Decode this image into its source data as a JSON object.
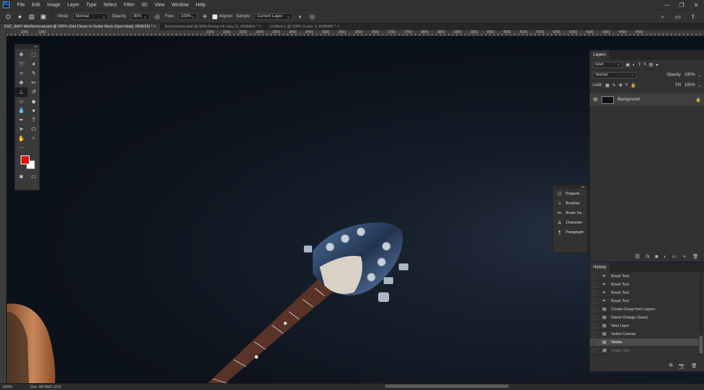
{
  "app": {
    "logo": "Ps"
  },
  "menu": [
    "File",
    "Edit",
    "Image",
    "Layer",
    "Type",
    "Select",
    "Filter",
    "3D",
    "View",
    "Window",
    "Help"
  ],
  "window_controls": {
    "minimize": "—",
    "restore": "❐",
    "close": "✕"
  },
  "options": {
    "mode_label": "Mode:",
    "mode_value": "Normal",
    "opacity_label": "Opacity:",
    "opacity_value": "30%",
    "flow_label": "Flow:",
    "flow_value": "100%",
    "aligned_label": "Aligned",
    "sample_label": "Sample:",
    "sample_value": "Current Layer"
  },
  "tabs": [
    "DSC_8497-MicRemoval.psd @ 200% (Get Closer to Guitar Neck (Spot Heal), RGB/16) * ×",
    "Screenshots.psd @ 50% (Group 14 copy 11, RGB/8#) * ×",
    "Untitled-1 @ 100% (Layer 2, RGB/8#) * ×"
  ],
  "ruler": [
    "1000",
    "1050",
    "3150",
    "3200",
    "3250",
    "3300",
    "3350",
    "3400",
    "3450",
    "3500",
    "3550",
    "3600",
    "3650",
    "3700",
    "3750",
    "3800",
    "3850",
    "3900",
    "3950",
    "4000",
    "4050",
    "4100",
    "4150",
    "4200",
    "4250",
    "4300",
    "4350",
    "4400",
    "4450"
  ],
  "status": {
    "zoom": "200%",
    "doc": "Doc: 86.5M/1.31G"
  },
  "layers_panel": {
    "title": "Layers",
    "kind_label": "Kind",
    "blend_mode": "Normal",
    "opacity_label": "Opacity:",
    "opacity_value": "100%",
    "lock_label": "Lock:",
    "fill_label": "Fill:",
    "fill_value": "100%",
    "layer_name": "Background"
  },
  "history_panel": {
    "title": "History",
    "items": [
      {
        "label": "Brush Tool",
        "icon": "brush-icon"
      },
      {
        "label": "Brush Tool",
        "icon": "brush-icon"
      },
      {
        "label": "Brush Tool",
        "icon": "brush-icon"
      },
      {
        "label": "Brush Tool",
        "icon": "brush-icon"
      },
      {
        "label": "Create Group from Layers",
        "icon": "document-icon"
      },
      {
        "label": "Name Change (Save)",
        "icon": "document-icon"
      },
      {
        "label": "New Layer",
        "icon": "document-icon"
      },
      {
        "label": "Select Canvas",
        "icon": "document-icon"
      },
      {
        "label": "Stroke",
        "icon": "document-icon"
      },
      {
        "label": "Image Size",
        "icon": "document-icon"
      }
    ]
  },
  "collapsed_panels": [
    "Properti...",
    "Brushes",
    "Brush Se...",
    "Character",
    "Paragraph"
  ]
}
